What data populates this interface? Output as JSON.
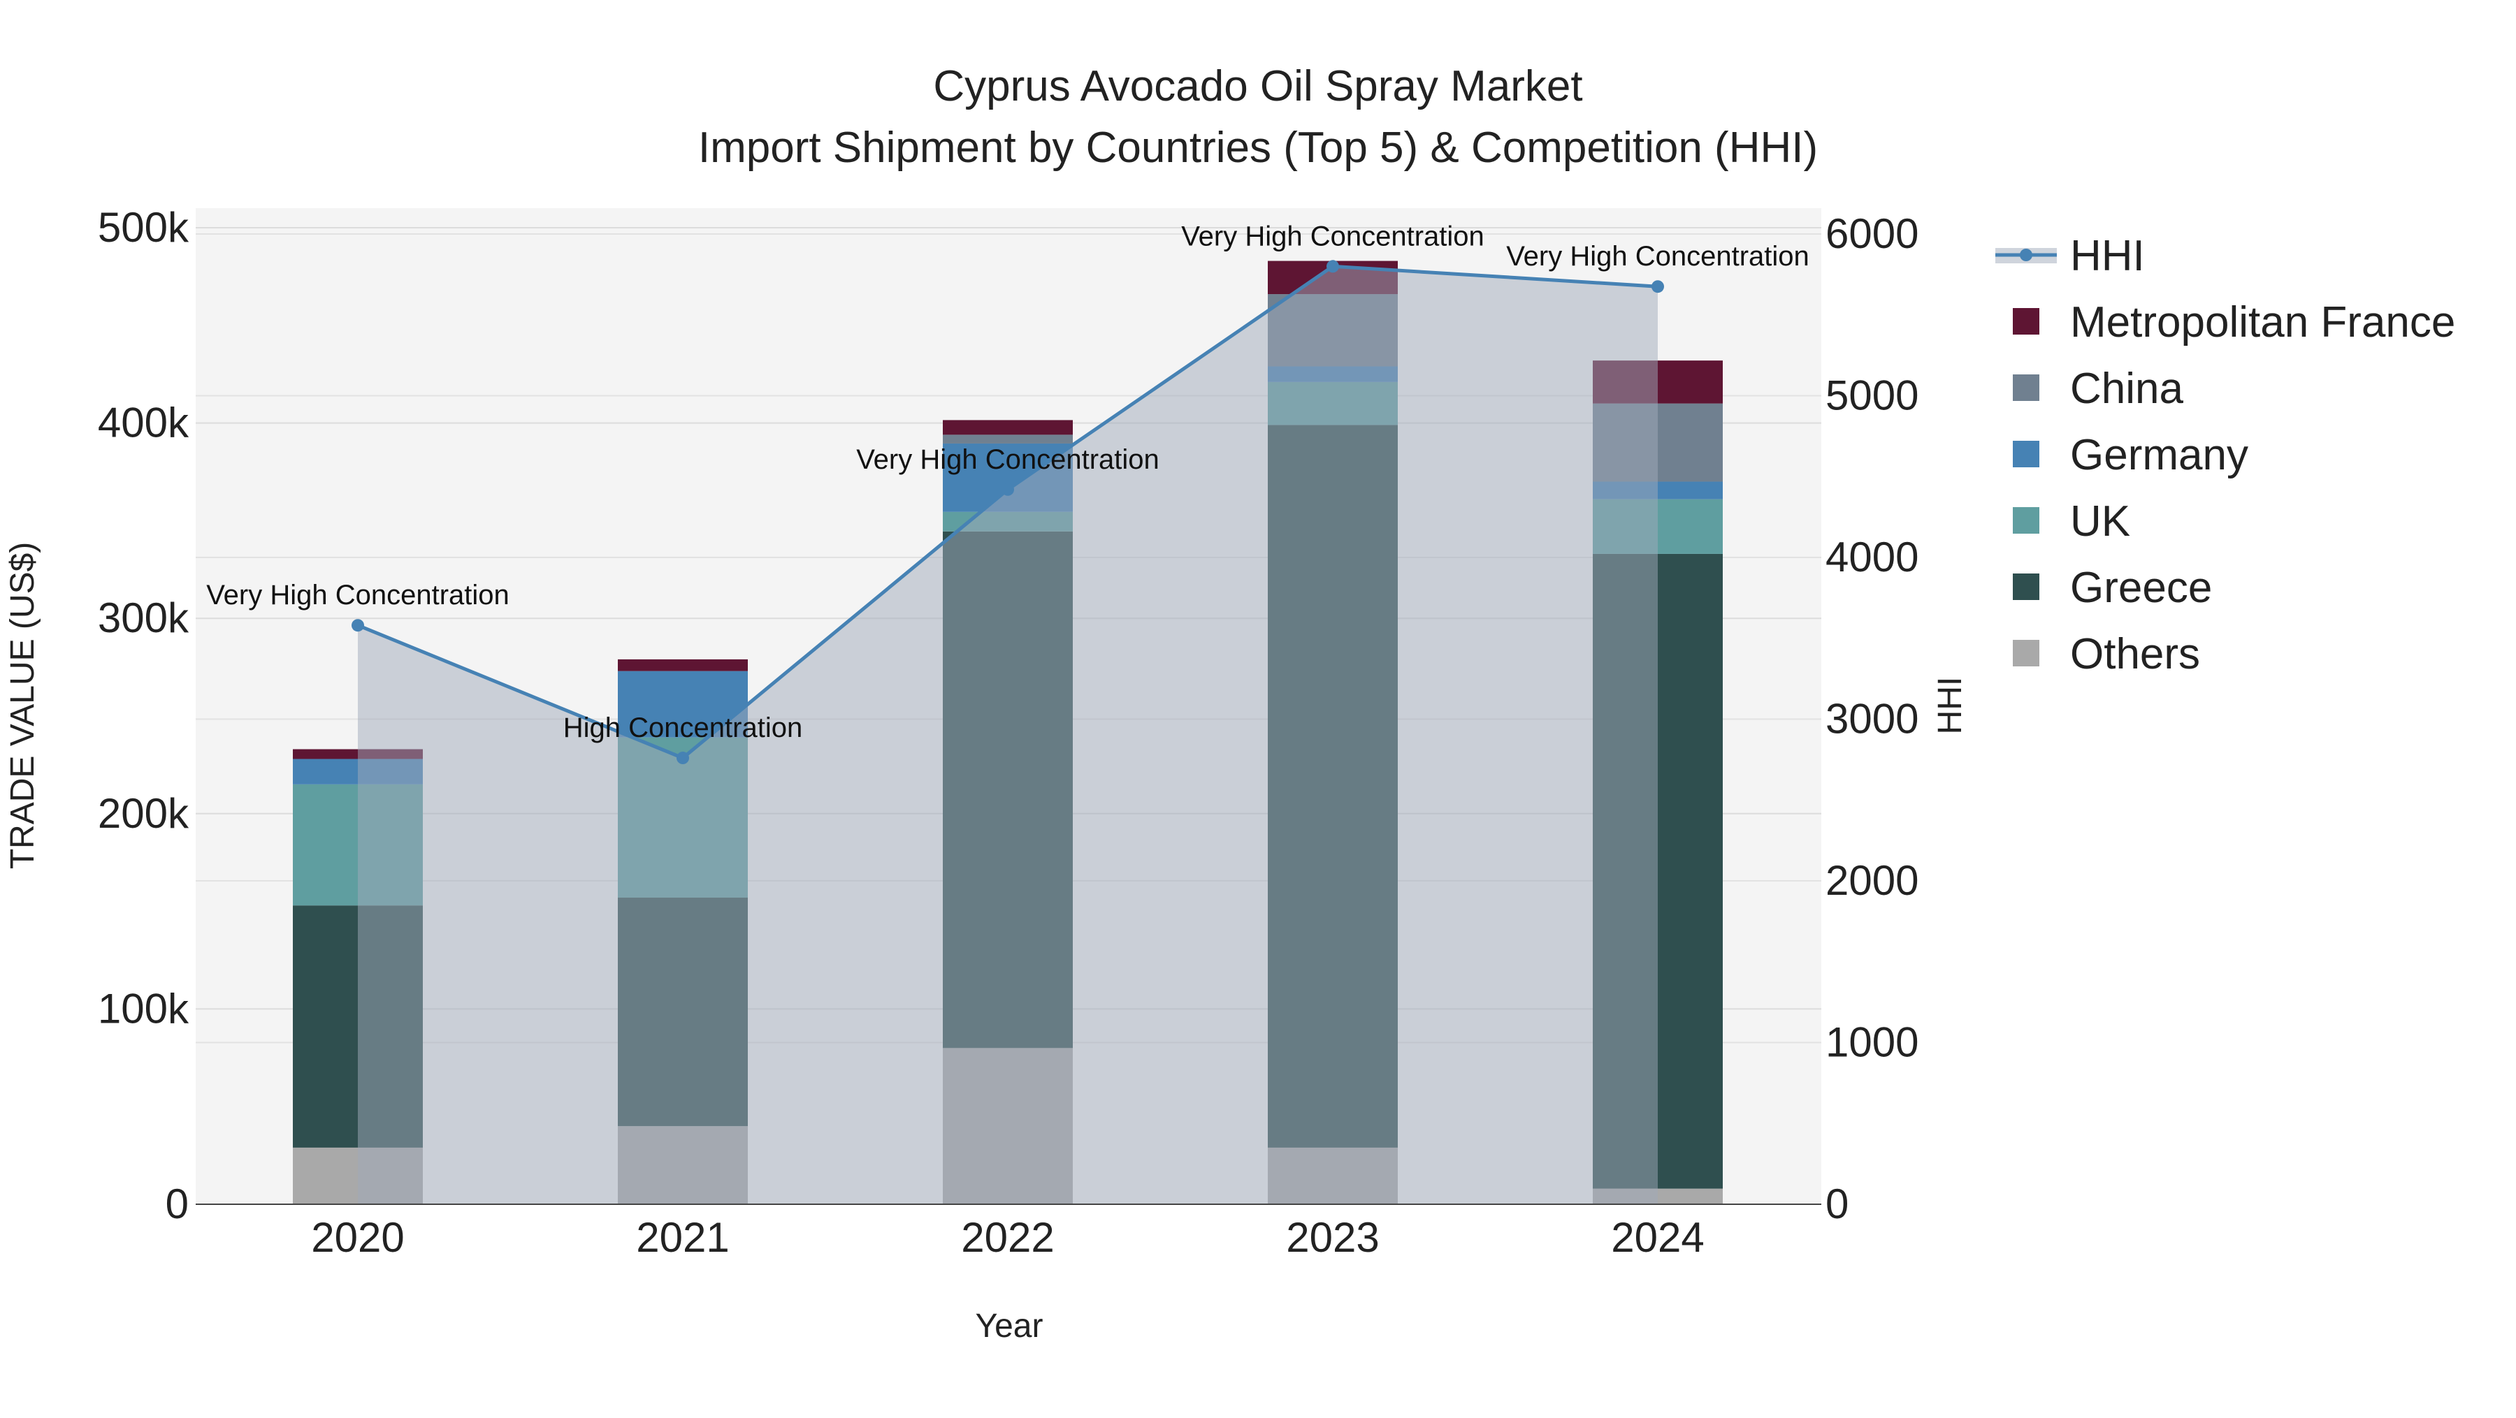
{
  "chart_data": {
    "type": "bar",
    "title_line1": "Cyprus Avocado Oil Spray Market",
    "title_line2": "Import Shipment by Countries (Top 5) & Competition (HHI)",
    "xlabel": "Year",
    "ylabel": "TRADE VALUE (US$)",
    "y2label": "HHI",
    "categories": [
      "2020",
      "2021",
      "2022",
      "2023",
      "2024"
    ],
    "ylim": [
      0,
      510000
    ],
    "y2lim": [
      0,
      6120
    ],
    "yticks": [
      0,
      100000,
      200000,
      300000,
      400000,
      500000
    ],
    "ytick_labels": [
      "0",
      "100k",
      "200k",
      "300k",
      "400k",
      "500k"
    ],
    "y2ticks": [
      0,
      1000,
      2000,
      3000,
      4000,
      5000,
      6000
    ],
    "y2tick_labels": [
      "0",
      "1000",
      "2000",
      "3000",
      "4000",
      "5000",
      "6000"
    ],
    "stacked": true,
    "series": [
      {
        "name": "Others",
        "color": "#a9a9a9",
        "values": [
          29000,
          40000,
          80000,
          29000,
          8000
        ]
      },
      {
        "name": "Greece",
        "color": "#2f4f4f",
        "values": [
          124000,
          117000,
          264500,
          370000,
          325000
        ]
      },
      {
        "name": "UK",
        "color": "#5f9ea0",
        "values": [
          62000,
          82000,
          10000,
          22000,
          28000
        ]
      },
      {
        "name": "Germany",
        "color": "#4682b4",
        "values": [
          13000,
          34000,
          35000,
          8000,
          9000
        ]
      },
      {
        "name": "China",
        "color": "#708090",
        "values": [
          0,
          0,
          4500,
          37000,
          40000
        ]
      },
      {
        "name": "Metropolitan France",
        "color": "#5e1533",
        "values": [
          5000,
          6000,
          7500,
          17000,
          22000
        ]
      }
    ],
    "hhi": {
      "name": "HHI",
      "color": "#4682b4",
      "values": [
        3580,
        2760,
        4420,
        5800,
        5675
      ],
      "annotations": [
        "Very High Concentration",
        "High Concentration",
        "Very High Concentration",
        "Very High Concentration",
        "Very High Concentration"
      ]
    },
    "legend_order": [
      "HHI",
      "Metropolitan France",
      "China",
      "Germany",
      "UK",
      "Greece",
      "Others"
    ],
    "legend_placement": "right",
    "grid": true
  }
}
